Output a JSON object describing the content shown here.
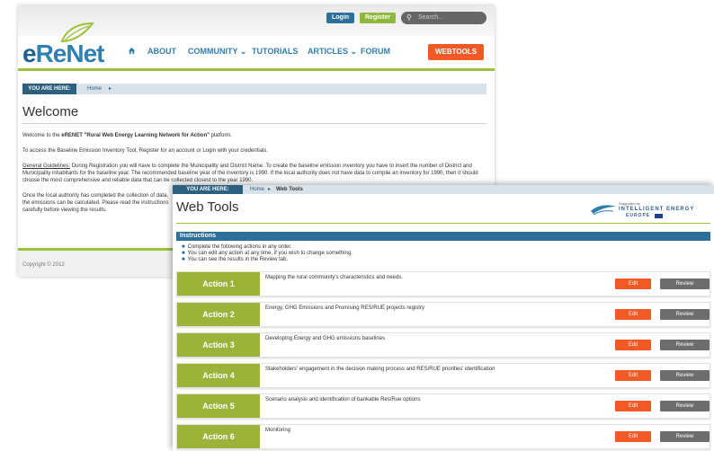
{
  "header": {
    "login_label": "Login",
    "register_label": "Register",
    "search_placeholder": "Search...",
    "logo_text_e": "e",
    "logo_text_rest": "ReNet",
    "nav": {
      "home_icon": "home-icon",
      "about": "ABOUT",
      "community": "COMMUNITY ⌄",
      "tutorials": "TUTORIALS",
      "articles": "ARTICLES ⌄",
      "forum": "FORUM"
    },
    "webtools_label": "WEBTOOLS"
  },
  "back_page": {
    "breadcrumb_label": "YOU ARE HERE:",
    "breadcrumb_home": "Home",
    "breadcrumb_arrow": "▸",
    "title": "Welcome",
    "para1_prefix": "Welcome to the ",
    "para1_bold": "eRENET \"Rural Web Energy Learning Network for Action\"",
    "para1_suffix": " platform.",
    "para2": "To access the Baseline Emission Inventory Tool, Register for an account or Login with your credentials.",
    "para3_label": "General Guidelines:",
    "para3": " During Registration you will have to complete the Municipality and District Name. To create the baseline emission inventory you have to insert the number of District and Municipality inhabitants for the baseline year. The recommended baseline year of the inventory is 1990. If the local authority does not have data to compile an inventory for 1990, then it should choose the most comprehensive and reliable data that can be collected closest to the year 1990.",
    "para4": "Once the local authority has completed the collection of data, the emissions can be calculated. Please read the instructions carefully before viewing the results.",
    "copyright": "Copyright © 2012"
  },
  "front_panel": {
    "breadcrumb_label": "YOU ARE HERE:",
    "breadcrumb_home": "Home",
    "breadcrumb_arrow": "▸",
    "breadcrumb_current": "Web Tools",
    "title": "Web Tools",
    "partner_small": "Supported by",
    "partner_line1": "INTELLIGENT ENERGY",
    "partner_line2": "EUROPE",
    "instructions_header": "Instructions",
    "instructions": [
      "Complete the following actions in any order.",
      "You can edit any action at any time, if you wish to change something.",
      "You can see the results in the Review tab."
    ],
    "bullet": "■",
    "edit_label": "Edit",
    "review_label": "Review",
    "actions": [
      {
        "label": "Action 1",
        "desc": "Mapping the rural community's characteristics and needs."
      },
      {
        "label": "Action 2",
        "desc": "Energy, GHG Emissions and Promising RES/RUE projects registry"
      },
      {
        "label": "Action 3",
        "desc": "Developing Energy and GHG emissions baselines"
      },
      {
        "label": "Action 4",
        "desc": "Stakeholders' engagement in the decision making process and RES/RUE priorities' identification"
      },
      {
        "label": "Action 5",
        "desc": "Scenario analysis and identification of bankable Res/Rue options"
      },
      {
        "label": "Action 6",
        "desc": "Monitoring"
      }
    ]
  },
  "colors": {
    "brand_blue": "#2f7fb0",
    "brand_green": "#9cc13a",
    "action_green": "#9cb33a",
    "edit_orange": "#f15a24",
    "review_gray": "#6d6d6d"
  }
}
